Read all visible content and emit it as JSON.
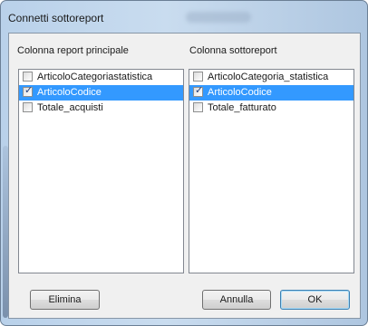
{
  "window": {
    "title": "Connetti sottoreport",
    "title_ghost": ""
  },
  "left": {
    "label": "Colonna report principale",
    "items": [
      {
        "label": "ArticoloCategoriastatistica",
        "checked": false,
        "selected": false
      },
      {
        "label": "ArticoloCodice",
        "checked": true,
        "selected": true
      },
      {
        "label": "Totale_acquisti",
        "checked": false,
        "selected": false
      }
    ]
  },
  "right": {
    "label": "Colonna sottoreport",
    "items": [
      {
        "label": "ArticoloCategoria_statistica",
        "checked": false,
        "selected": false
      },
      {
        "label": "ArticoloCodice",
        "checked": true,
        "selected": true
      },
      {
        "label": "Totale_fatturato",
        "checked": false,
        "selected": false
      }
    ]
  },
  "buttons": {
    "delete": "Elimina",
    "cancel": "Annulla",
    "ok": "OK"
  },
  "colors": {
    "selection": "#3399ff",
    "dialog_bg": "#f0f0f0",
    "frame": "#b9d1ea"
  }
}
